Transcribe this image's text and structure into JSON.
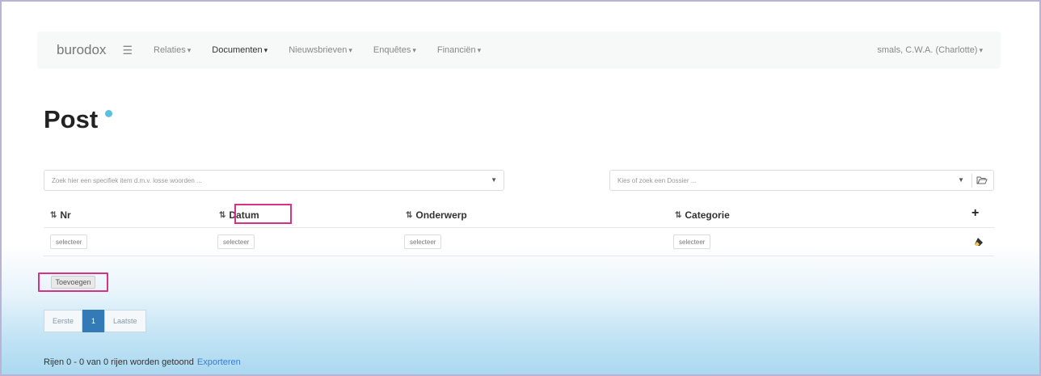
{
  "navbar": {
    "brand": "burodox",
    "menu_icon": "hamburger-icon",
    "items": [
      {
        "label": "Relaties",
        "caret": "▾"
      },
      {
        "label": "Documenten",
        "caret": "▾"
      },
      {
        "label": "Nieuwsbrieven",
        "caret": "▾"
      },
      {
        "label": "Enquêtes",
        "caret": "▾"
      },
      {
        "label": "Financiën",
        "caret": "▾"
      }
    ],
    "user": "smals, C.W.A. (Charlotte)",
    "user_caret": "▾"
  },
  "page": {
    "title": "Post",
    "info_icon": "info-dot-icon"
  },
  "search": {
    "placeholder": "Zoek hier een specifiek item d.m.v. losse woorden ...",
    "dossier_placeholder": "Kies of zoek een Dossier ..."
  },
  "table": {
    "sort_glyph": "⇅",
    "columns": [
      "Nr",
      "Datum",
      "Onderwerp",
      "Categorie"
    ],
    "filter_label": "selecteer"
  },
  "actions": {
    "add_label": "Toevoegen"
  },
  "pagination": {
    "first": "Eerste",
    "current": "1",
    "last": "Laatste"
  },
  "footer": {
    "summary": "Rijen 0 - 0 van 0 rijen worden getoond",
    "export": "Exporteren"
  },
  "colors": {
    "highlight": "#d63384",
    "primary": "#337ab7",
    "info": "#5bc0de",
    "link": "#3a7bd5"
  }
}
